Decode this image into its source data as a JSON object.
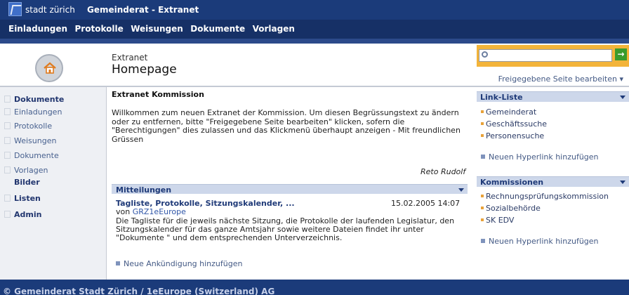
{
  "header": {
    "brand": "stadt zürich",
    "title": "Gemeinderat - Extranet"
  },
  "nav": [
    "Einladungen",
    "Protokolle",
    "Weisungen",
    "Dokumente",
    "Vorlagen"
  ],
  "page": {
    "breadcrumb": "Extranet",
    "title": "Homepage"
  },
  "search": {
    "value": "",
    "placeholder": "",
    "go_label": "→"
  },
  "edit_shared_link": "Freigegebene Seite bearbeiten ▾",
  "sidebar": {
    "dokumente": "Dokumente",
    "items": [
      "Einladungen",
      "Protokolle",
      "Weisungen",
      "Dokumente",
      "Vorlagen"
    ],
    "bilder": "Bilder",
    "listen": "Listen",
    "admin": "Admin"
  },
  "main": {
    "heading": "Extranet Kommission",
    "welcome": "Willkommen zum neuen Extranet der Kommission. Um diesen Begrüssungstext zu ändern oder zu entfernen, bitte \"Freigegebene Seite bearbeiten\" klicken, sofern die \"Berechtigungen\" dies zulassen und das Klickmenü überhaupt anzeigen - Mit freundlichen Grüssen",
    "signature": "Reto Rudolf",
    "mitteilungen": {
      "title": "Mitteilungen",
      "item_title": "Tagliste, Protokolle, Sitzungskalender, ...",
      "date": "15.02.2005 14:07",
      "by_prefix": "von",
      "author": "GRZ1eEurope",
      "body": "Die Tagliste für die jeweils nächste Sitzung, die Protokolle der laufenden Legislatur, den Sitzungskalender für das ganze Amtsjahr sowie weitere Dateien findet ihr unter \"Dokumente \" und dem entsprechenden Unterverzeichnis.",
      "add_label": "Neue Ankündigung hinzufügen"
    }
  },
  "right": {
    "linkliste": {
      "title": "Link-Liste",
      "links": [
        "Gemeinderat",
        "Geschäftssuche",
        "Personensuche"
      ],
      "add_label": "Neuen Hyperlink hinzufügen"
    },
    "kommissionen": {
      "title": "Kommissionen",
      "links": [
        "Rechnungsprüfungskommission",
        "Sozialbehörde",
        "SK EDV"
      ],
      "add_label": "Neuen Hyperlink hinzufügen"
    }
  },
  "footer": {
    "text": "© Gemeinderat Stadt Zürich / 1eEurope (Switzerland) AG"
  },
  "colors": {
    "header_bg": "#1b3b7a",
    "accent_orange": "#f3b43a",
    "bar_bg": "#cdd7ea",
    "link": "#445a85"
  }
}
